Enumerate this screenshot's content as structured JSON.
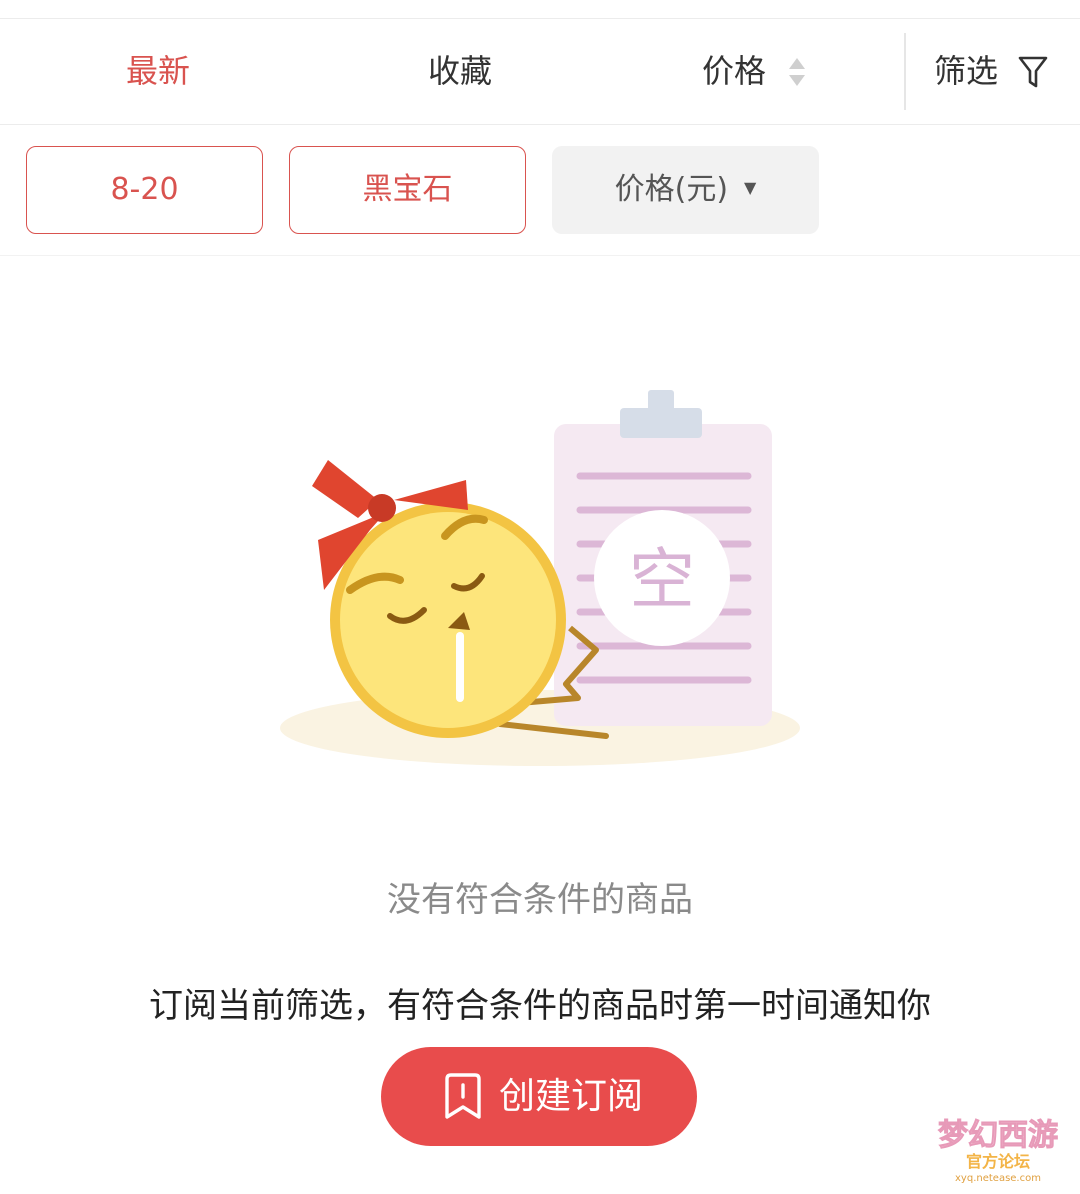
{
  "sort_bar": {
    "latest": "最新",
    "favorites": "收藏",
    "price": "价格",
    "filter": "筛选"
  },
  "chips": {
    "level": "8-20",
    "server": "黑宝石",
    "price": "价格(元)"
  },
  "illustration": {
    "empty_badge": "空"
  },
  "empty_state": {
    "message": "没有符合条件的商品",
    "subscribe_hint": "订阅当前筛选，有符合条件的商品时第一时间通知你",
    "create_button": "创建订阅"
  },
  "watermark": {
    "text": "梦幻西游",
    "sub": "官方论坛",
    "url": "xyq.netease.com"
  },
  "colors": {
    "accent": "#d9534f",
    "button": "#e84c4c",
    "chip_grey": "#f2f2f2"
  }
}
